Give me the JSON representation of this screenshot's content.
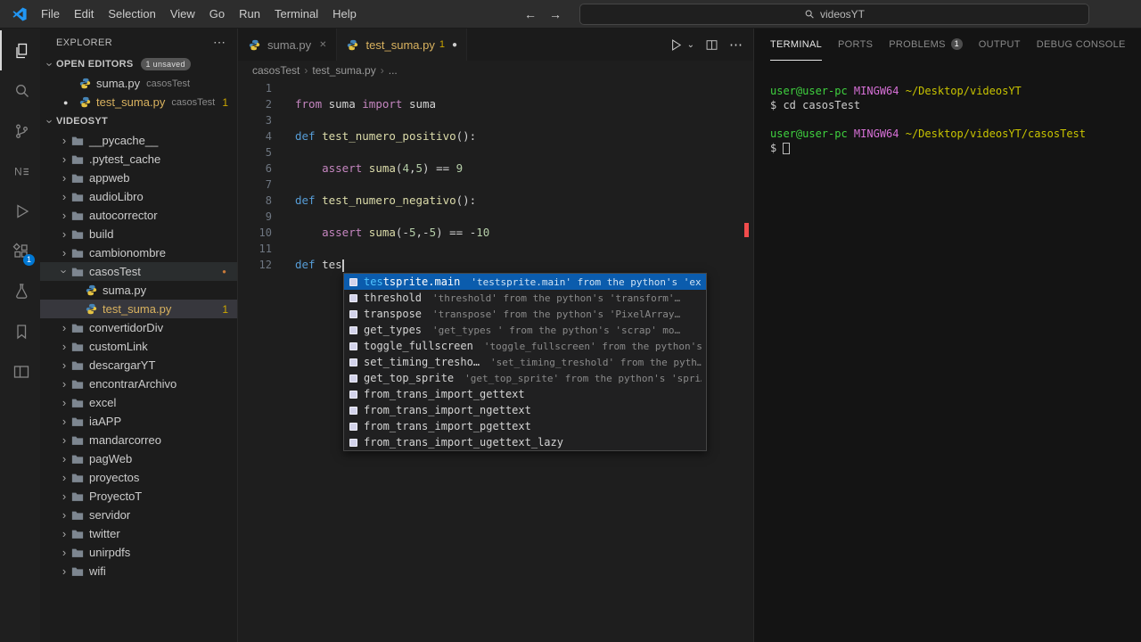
{
  "colors": {
    "accent_blue": "#0078d4",
    "warning_gold": "#cca700",
    "suggest_selection": "#0b5cad",
    "terminal_green": "#3fd23f",
    "terminal_magenta": "#d670d6",
    "terminal_yellow": "#c9c400",
    "overview_marker_red": "#f14c4c"
  },
  "title_bar": {
    "menus": [
      "File",
      "Edit",
      "Selection",
      "View",
      "Go",
      "Run",
      "Terminal",
      "Help"
    ],
    "search_text": "videosYT"
  },
  "activity_bar": {
    "extensions_badge": "1"
  },
  "sidebar": {
    "title": "EXPLORER",
    "open_editors": {
      "label": "OPEN EDITORS",
      "badge": "1 unsaved",
      "items": [
        {
          "label": "suma.py",
          "desc": "casosTest",
          "modified": false
        },
        {
          "label": "test_suma.py",
          "desc": "casosTest",
          "modified": true,
          "warning": true,
          "count": "1"
        }
      ]
    },
    "tree": {
      "root": "VIDEOSYT",
      "items": [
        {
          "label": "__pycache__",
          "type": "folder"
        },
        {
          "label": ".pytest_cache",
          "type": "folder"
        },
        {
          "label": "appweb",
          "type": "folder"
        },
        {
          "label": "audioLibro",
          "type": "folder"
        },
        {
          "label": "autocorrector",
          "type": "folder"
        },
        {
          "label": "build",
          "type": "folder"
        },
        {
          "label": "cambionombre",
          "type": "folder"
        },
        {
          "label": "casosTest",
          "type": "folder",
          "expanded": true,
          "highlight": true,
          "dot": true
        },
        {
          "label": "suma.py",
          "type": "python",
          "level": 1
        },
        {
          "label": "test_suma.py",
          "type": "python",
          "level": 1,
          "selected": true,
          "warning": true,
          "count": "1"
        },
        {
          "label": "convertidorDiv",
          "type": "folder"
        },
        {
          "label": "customLink",
          "type": "folder"
        },
        {
          "label": "descargarYT",
          "type": "folder"
        },
        {
          "label": "encontrarArchivo",
          "type": "folder"
        },
        {
          "label": "excel",
          "type": "folder"
        },
        {
          "label": "iaAPP",
          "type": "folder"
        },
        {
          "label": "mandarcorreo",
          "type": "folder"
        },
        {
          "label": "pagWeb",
          "type": "folder"
        },
        {
          "label": "proyectos",
          "type": "folder"
        },
        {
          "label": "ProyectoT",
          "type": "folder"
        },
        {
          "label": "servidor",
          "type": "folder"
        },
        {
          "label": "twitter",
          "type": "folder"
        },
        {
          "label": "unirpdfs",
          "type": "folder"
        },
        {
          "label": "wifi",
          "type": "folder"
        }
      ]
    }
  },
  "editor": {
    "tabs": [
      {
        "label": "suma.py",
        "active": false
      },
      {
        "label": "test_suma.py",
        "active": true,
        "modified": true,
        "warning": true,
        "count": "1"
      }
    ],
    "breadcrumbs": [
      "casosTest",
      "test_suma.py",
      "..."
    ],
    "lines": [
      {
        "num": "1",
        "tokens": []
      },
      {
        "num": "2",
        "tokens": [
          {
            "t": "from",
            "c": "ctrl"
          },
          {
            "t": " suma ",
            "c": "plain"
          },
          {
            "t": "import",
            "c": "ctrl"
          },
          {
            "t": " suma",
            "c": "plain"
          }
        ]
      },
      {
        "num": "3",
        "tokens": []
      },
      {
        "num": "4",
        "tokens": [
          {
            "t": "def",
            "c": "kw"
          },
          {
            "t": " ",
            "c": "plain"
          },
          {
            "t": "test_numero_positivo",
            "c": "fn"
          },
          {
            "t": "():",
            "c": "plain"
          }
        ]
      },
      {
        "num": "5",
        "tokens": []
      },
      {
        "num": "6",
        "tokens": [
          {
            "t": "    ",
            "c": "plain"
          },
          {
            "t": "assert",
            "c": "ctrl"
          },
          {
            "t": " ",
            "c": "plain"
          },
          {
            "t": "suma",
            "c": "fn"
          },
          {
            "t": "(",
            "c": "plain"
          },
          {
            "t": "4",
            "c": "num"
          },
          {
            "t": ",",
            "c": "plain"
          },
          {
            "t": "5",
            "c": "num"
          },
          {
            "t": ") == ",
            "c": "plain"
          },
          {
            "t": "9",
            "c": "num"
          }
        ]
      },
      {
        "num": "7",
        "tokens": []
      },
      {
        "num": "8",
        "tokens": [
          {
            "t": "def",
            "c": "kw"
          },
          {
            "t": " ",
            "c": "plain"
          },
          {
            "t": "test_numero_negativo",
            "c": "fn"
          },
          {
            "t": "():",
            "c": "plain"
          }
        ]
      },
      {
        "num": "9",
        "tokens": []
      },
      {
        "num": "10",
        "tokens": [
          {
            "t": "    ",
            "c": "plain"
          },
          {
            "t": "assert",
            "c": "ctrl"
          },
          {
            "t": " ",
            "c": "plain"
          },
          {
            "t": "suma",
            "c": "fn"
          },
          {
            "t": "(-",
            "c": "plain"
          },
          {
            "t": "5",
            "c": "num"
          },
          {
            "t": ",-",
            "c": "plain"
          },
          {
            "t": "5",
            "c": "num"
          },
          {
            "t": ") == -",
            "c": "plain"
          },
          {
            "t": "10",
            "c": "num"
          }
        ]
      },
      {
        "num": "11",
        "tokens": []
      },
      {
        "num": "12",
        "tokens": [
          {
            "t": "def",
            "c": "kw"
          },
          {
            "t": " tes",
            "c": "plain"
          }
        ],
        "cursor": true
      }
    ]
  },
  "suggest": {
    "items": [
      {
        "label": "testsprite.main",
        "match": "tes",
        "desc": "'testsprite.main' from the python's 'ex…",
        "selected": true
      },
      {
        "label": "threshold",
        "desc": "'threshold' from the python's 'transform'…"
      },
      {
        "label": "transpose",
        "desc": "'transpose' from the python's 'PixelArray…"
      },
      {
        "label": "get_types",
        "desc": "'get_types ' from the python's 'scrap' mo…"
      },
      {
        "label": "toggle_fullscreen",
        "desc": "'toggle_fullscreen' from the python's…"
      },
      {
        "label": "set_timing_tresho…",
        "desc": "'set_timing_treshold' from the pyth…"
      },
      {
        "label": "get_top_sprite",
        "desc": "'get_top_sprite' from the python's 'spri…"
      },
      {
        "label": "from_trans_import_gettext"
      },
      {
        "label": "from_trans_import_ngettext"
      },
      {
        "label": "from_trans_import_pgettext"
      },
      {
        "label": "from_trans_import_ugettext_lazy"
      }
    ]
  },
  "panel": {
    "tabs": [
      {
        "label": "TERMINAL",
        "active": true
      },
      {
        "label": "PORTS"
      },
      {
        "label": "PROBLEMS",
        "badge": "1"
      },
      {
        "label": "OUTPUT"
      },
      {
        "label": "DEBUG CONSOLE"
      }
    ],
    "terminal_lines": [
      {
        "segments": [
          {
            "text": "user@user-pc ",
            "c": "green"
          },
          {
            "text": "MINGW64 ",
            "c": "magenta"
          },
          {
            "text": "~/Desktop/videosYT",
            "c": "yellow"
          }
        ]
      },
      {
        "segments": [
          {
            "text": "$ cd casosTest",
            "c": "fg"
          }
        ]
      },
      {
        "segments": []
      },
      {
        "segments": [
          {
            "text": "user@user-pc ",
            "c": "green"
          },
          {
            "text": "MINGW64 ",
            "c": "magenta"
          },
          {
            "text": "~/Desktop/videosYT/casosTest",
            "c": "yellow"
          }
        ]
      },
      {
        "segments": [
          {
            "text": "$ ",
            "c": "fg"
          }
        ],
        "cursor": true
      }
    ]
  }
}
